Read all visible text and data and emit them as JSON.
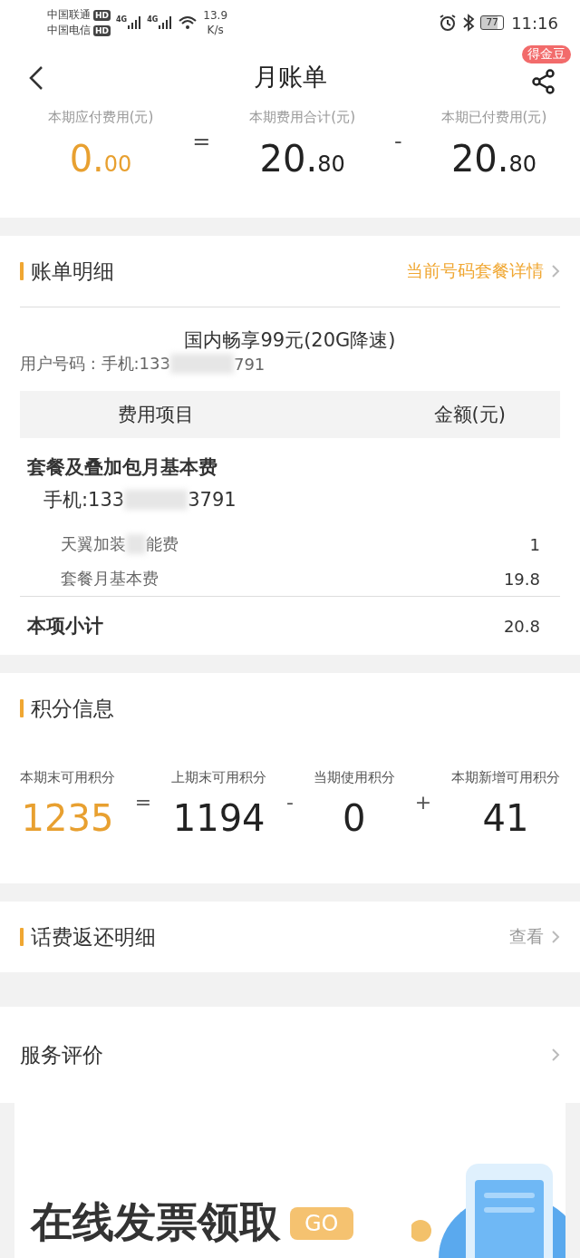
{
  "status_bar": {
    "carriers": [
      {
        "name": "中国联通",
        "badge": "HD"
      },
      {
        "name": "中国电信",
        "badge": "HD"
      }
    ],
    "networks": [
      "4G",
      "4G"
    ],
    "speed": "13.9",
    "speed_unit": "K/s",
    "battery": "77",
    "time": "11:16"
  },
  "header": {
    "title": "月账单",
    "badge": "得金豆"
  },
  "summary": {
    "items": [
      {
        "label": "本期应付费用(元)",
        "integer": "0.",
        "decimal": "00",
        "highlight": true
      },
      {
        "label": "本期费用合计(元)",
        "integer": "20.",
        "decimal": "80",
        "highlight": false
      },
      {
        "label": "本期已付费用(元)",
        "integer": "20.",
        "decimal": "80",
        "highlight": false
      }
    ],
    "operators": [
      "=",
      "-"
    ]
  },
  "bill": {
    "title": "账单明细",
    "link": "当前号码套餐详情",
    "plan": "国内畅享99元(20G降速)",
    "user_prefix": "用户号码 : 手机:133",
    "user_suffix": "791",
    "columns": [
      "费用项目",
      "金额(元)"
    ],
    "group": "套餐及叠加包月基本费",
    "phone_prefix": "手机:133",
    "phone_suffix": "3791",
    "items": [
      {
        "name": "天翼加装",
        "name_suffix": "能费",
        "amount": "1"
      },
      {
        "name": "套餐月基本费",
        "amount": "19.8"
      }
    ],
    "subtotal_label": "本项小计",
    "subtotal": "20.8"
  },
  "points": {
    "title": "积分信息",
    "items": [
      {
        "label": "本期末可用积分",
        "value": "1235",
        "highlight": true
      },
      {
        "label": "上期末可用积分",
        "value": "1194",
        "highlight": false
      },
      {
        "label": "当期使用积分",
        "value": "0",
        "highlight": false
      },
      {
        "label": "本期新增可用积分",
        "value": "41",
        "highlight": false
      }
    ],
    "operators": [
      "=",
      "-",
      "+"
    ]
  },
  "refund": {
    "title": "话费返还明细",
    "link": "查看"
  },
  "rating": {
    "title": "服务评价"
  },
  "banner": {
    "title": "在线发票领取",
    "button": "GO"
  }
}
